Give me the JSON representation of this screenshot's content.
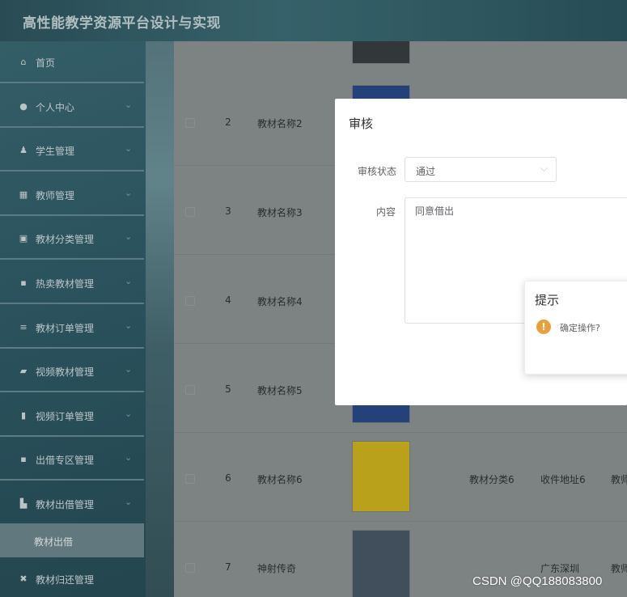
{
  "header": {
    "title": "高性能教学资源平台设计与实现"
  },
  "sidebar": {
    "items": [
      {
        "label": "首页",
        "icon": "home-icon",
        "glyph": "⌂",
        "has_children": false
      },
      {
        "label": "个人中心",
        "icon": "user-icon",
        "glyph": "●",
        "has_children": true
      },
      {
        "label": "学生管理",
        "icon": "student-icon",
        "glyph": "♟",
        "has_children": true
      },
      {
        "label": "教师管理",
        "icon": "grid-icon",
        "glyph": "▦",
        "has_children": true
      },
      {
        "label": "教材分类管理",
        "icon": "checkbox-icon",
        "glyph": "▣",
        "has_children": true
      },
      {
        "label": "热卖教材管理",
        "icon": "apps-icon",
        "glyph": "▪",
        "has_children": true
      },
      {
        "label": "教材订单管理",
        "icon": "list-icon",
        "glyph": "≡",
        "has_children": true
      },
      {
        "label": "视频教材管理",
        "icon": "folder-icon",
        "glyph": "▰",
        "has_children": true
      },
      {
        "label": "视频订单管理",
        "icon": "bar-chart-icon",
        "glyph": "▮",
        "has_children": true
      },
      {
        "label": "出借专区管理",
        "icon": "apps-icon",
        "glyph": "▪",
        "has_children": true
      },
      {
        "label": "教材出借管理",
        "icon": "book-icon",
        "glyph": "▙",
        "has_children": true
      }
    ],
    "submenu_label": "教材出借",
    "last_item": {
      "label": "教材归还管理",
      "icon": "exchange-icon",
      "glyph": "✖"
    }
  },
  "table": {
    "rows": [
      {
        "index": "2",
        "name": "教材名称2",
        "category": "",
        "address": "",
        "teacher": ""
      },
      {
        "index": "3",
        "name": "教材名称3",
        "category": "",
        "address": "",
        "teacher": ""
      },
      {
        "index": "4",
        "name": "教材名称4",
        "category": "",
        "address": "",
        "teacher": ""
      },
      {
        "index": "5",
        "name": "教材名称5",
        "category": "",
        "address": "",
        "teacher": ""
      },
      {
        "index": "6",
        "name": "教材名称6",
        "category": "教材分类6",
        "address": "收件地址6",
        "teacher": "教师"
      },
      {
        "index": "7",
        "name": "神射传奇",
        "category": "",
        "address": "广东深圳",
        "teacher": "教师"
      }
    ]
  },
  "audit_dialog": {
    "title": "审核",
    "status_label": "审核状态",
    "status_value": "通过",
    "content_label": "内容",
    "content_value": "同意借出"
  },
  "confirm_popup": {
    "title": "提示",
    "message": "确定操作?",
    "icon": "warning-icon"
  },
  "watermark": "CSDN @QQ188083800",
  "colors": {
    "header_bg": "#3f6f79",
    "sidebar_bg": "#34626e",
    "warning": "#e6a23c"
  }
}
